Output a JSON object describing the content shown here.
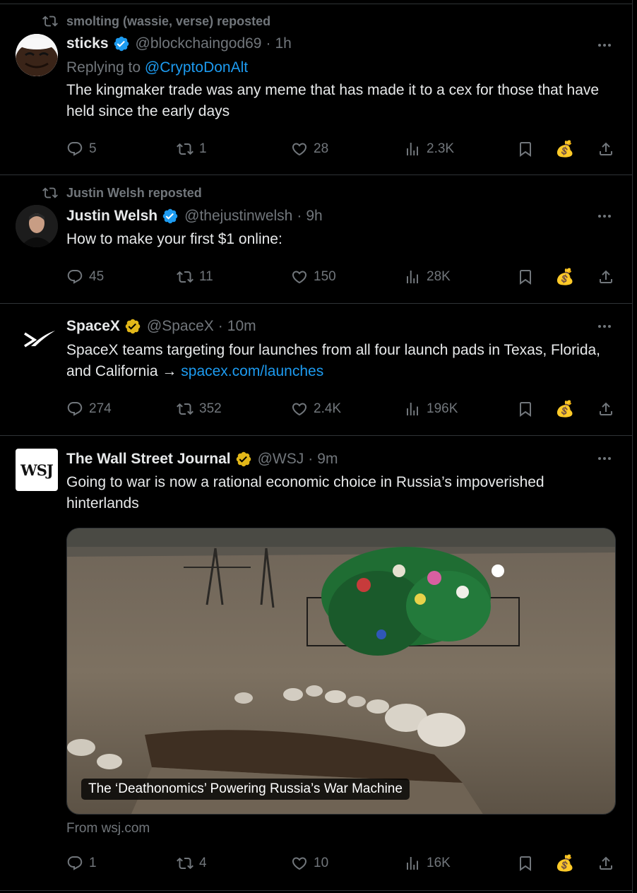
{
  "tweets": [
    {
      "repost_label": "smolting (wassie, verse) reposted",
      "name": "sticks",
      "handle": "@blockchaingod69",
      "dot": "·",
      "time": "1h",
      "verified": "blue",
      "reply_prefix": "Replying to",
      "reply_handle": "@CryptoDonAlt",
      "text": "The kingmaker trade was any meme that has made it to a cex for those that have held since the early days",
      "replies": "5",
      "reposts": "1",
      "likes": "28",
      "views": "2.3K"
    },
    {
      "repost_label": "Justin Welsh reposted",
      "name": "Justin Welsh",
      "handle": "@thejustinwelsh",
      "dot": "·",
      "time": "9h",
      "verified": "blue",
      "text": "How to make your first $1 online:",
      "replies": "45",
      "reposts": "11",
      "likes": "150",
      "views": "28K"
    },
    {
      "name": "SpaceX",
      "handle": "@SpaceX",
      "dot": "·",
      "time": "10m",
      "verified": "gold",
      "text": "SpaceX teams targeting four launches from all four launch pads in Texas, Florida, and California →",
      "link": "spacex.com/launches",
      "replies": "274",
      "reposts": "352",
      "likes": "2.4K",
      "views": "196K"
    },
    {
      "name": "The Wall Street Journal",
      "handle": "@WSJ",
      "dot": "·",
      "time": "9m",
      "verified": "gold",
      "avatar_text": "WSJ",
      "text": "Going to war is now a rational economic choice in Russia’s impoverished hinterlands",
      "card_title": "The ‘Deathonomics’ Powering Russia’s War Machine",
      "card_source": "From wsj.com",
      "replies": "1",
      "reposts": "4",
      "likes": "10",
      "views": "16K"
    }
  ],
  "icons": {
    "reply": "reply-icon",
    "repost": "repost-icon",
    "like": "heart-icon",
    "views": "views-icon",
    "bookmark": "bookmark-icon",
    "tip": "money-bag-icon",
    "share": "share-icon",
    "more": "more-icon",
    "verified": "verified-badge-icon"
  },
  "tip_emoji": "💰",
  "colors": {
    "background": "#000000",
    "text": "#e7e9ea",
    "muted": "#71767b",
    "link": "#1d9bf0",
    "blue_badge": "#1d9bf0",
    "gold_badge": "#e2b719",
    "divider": "#2f3336"
  }
}
